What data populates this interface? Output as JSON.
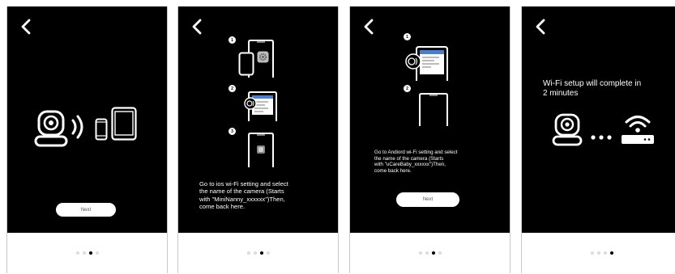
{
  "screens": [
    {
      "next_label": "Next",
      "icons": [
        "back-arrow-icon",
        "camera-icon",
        "signal-waves-icon",
        "phone-icon",
        "tablet-icon"
      ],
      "dots": {
        "count": 4,
        "active": 3
      }
    },
    {
      "steps": [
        "1",
        "2",
        "3"
      ],
      "instruction": "Go to ios wi-Fi setting and select\nthe name of the camera (Starts\nwith \"MiniNanny_xxxxxx\")Then,\ncome back here.",
      "icons": [
        "back-arrow-icon",
        "phone-icon",
        "tablet-icon",
        "settings-app-icon",
        "camera-icon"
      ],
      "dots": {
        "count": 4,
        "active": 3
      }
    },
    {
      "steps": [
        "1",
        "2"
      ],
      "instruction": "Go to Andiord wi-Fi setting and select\nthe name of the camera (Starts\nwith \"uCareBaby_xxxxxx\")Then,\ncome back here.",
      "next_label": "Next",
      "icons": [
        "back-arrow-icon",
        "camera-icon",
        "tablet-icon"
      ],
      "dots": {
        "count": 4,
        "active": 3
      }
    },
    {
      "title": "Wi-Fi setup will complete in\n2 minutes",
      "icons": [
        "back-arrow-icon",
        "camera-icon",
        "ellipsis-icon",
        "wifi-router-icon"
      ],
      "dots": {
        "count": 4,
        "active": 4
      }
    }
  ]
}
